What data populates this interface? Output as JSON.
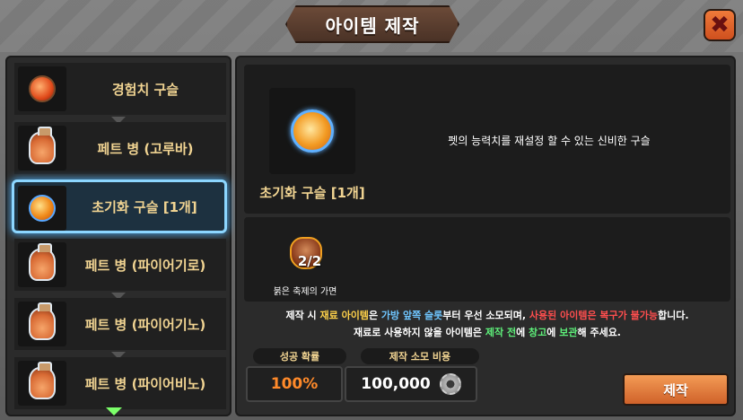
{
  "window": {
    "title": "아이템 제작",
    "close_icon": "close-x-icon"
  },
  "recipe_list": {
    "items": [
      {
        "label": "경험치 구슬",
        "icon": "exp-orb-icon",
        "selected": false
      },
      {
        "label": "페트 병 (고루바)",
        "icon": "pet-bottle-icon",
        "selected": false
      },
      {
        "label": "초기화 구슬 [1개]",
        "icon": "reset-orb-icon",
        "selected": true
      },
      {
        "label": "페트 병 (파이어기로)",
        "icon": "pet-bottle-icon",
        "selected": false
      },
      {
        "label": "페트 병 (파이어기노)",
        "icon": "pet-bottle-icon",
        "selected": false
      },
      {
        "label": "페트 병 (파이어비노)",
        "icon": "pet-bottle-icon",
        "selected": false
      }
    ]
  },
  "detail": {
    "item_name": "초기화 구슬 [1개]",
    "item_icon": "reset-orb-icon",
    "description": "펫의 능력치를 재설정 할 수 있는 신비한 구슬"
  },
  "materials": [
    {
      "name": "붉은 축제의 가면",
      "count": "2/2",
      "icon": "red-festival-mask-icon"
    }
  ],
  "notice": {
    "line1": {
      "p1": "제작 시 ",
      "h1": "재료 아이템",
      "p2": "은 ",
      "h2": "가방 앞쪽 슬롯",
      "p3": "부터 우선 소모되며, ",
      "h3": "사용된 아이템은 복구가 불가능",
      "p4": "합니다."
    },
    "line2": {
      "p1": "재료로 사용하지 않을 아이템은 ",
      "h1": "제작 전",
      "p2": "에 ",
      "h2": "창고",
      "p3": "에 ",
      "h3": "보관",
      "p4": "해 주세요."
    }
  },
  "success_rate": {
    "label": "성공 확률",
    "value": "100%"
  },
  "cost": {
    "label": "제작 소모 비용",
    "value": "100,000",
    "icon": "gear-coin-icon"
  },
  "craft_button": {
    "label": "제작"
  },
  "colors": {
    "accent_gold": "#f1d492",
    "selected_border": "#8cd6ff",
    "rate_orange": "#ff8a2a",
    "button_orange": "#e07a3a"
  }
}
